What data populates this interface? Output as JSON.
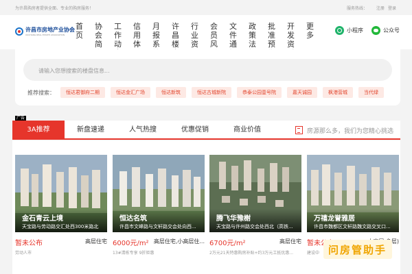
{
  "topbar": {
    "slogan": "为许昌购房者提供全面、专业的购房服务！",
    "service_hotline": "服务热线：",
    "register": "注册",
    "login": "登录"
  },
  "logo": {
    "name": "许昌市房地产业协会",
    "subtitle": "XUCHANG REAL ESTATE ASSOCIATION"
  },
  "nav": [
    "首页",
    "协会简介",
    "工作动态",
    "信用体系",
    "月报系统",
    "许昌楼盘",
    "行业资讯",
    "会员风采",
    "文件通知",
    "政策法规",
    "批准预售",
    "开发资质",
    "更多"
  ],
  "social": {
    "mini_program": "小程序",
    "official_account": "公众号"
  },
  "search": {
    "placeholder": "请输入您想搜索的楼盘信息...",
    "hot_label": "推荐搜索：",
    "tags": [
      "恒达君御府二期",
      "恒达金汇广场",
      "恒达新筑",
      "恒达古城新院",
      "恭泰公园壹号院",
      "嘉天诚园",
      "枫港营城",
      "当代绿"
    ]
  },
  "ad_label": "广告",
  "tabs": [
    "3A推荐",
    "新盘速递",
    "人气热搜",
    "优惠促销",
    "商业价值"
  ],
  "tab_search_text": "房源那么多，我们为您精心挑选",
  "listings": [
    {
      "name": "金石青云上境",
      "address": "天宝路与劳动路交汇处西300米路北",
      "price": "暂未公布",
      "type": "高层住宅",
      "sub": "劳动人市"
    },
    {
      "name": "恒达名筑",
      "address": "许昌市文峰路与文轩路交会处向西...",
      "price": "6000元/m²",
      "type": "高层住宅,小高层住...",
      "sub": "13#清栋专享 9折钜惠"
    },
    {
      "name": "腾飞华豫榭",
      "address": "天宝路与许州路交会处西北（高铁...",
      "price": "6700元/m²",
      "type": "高层住宅",
      "sub": "2万元21天特惠购房补贴+约3万元工抵优惠..."
    },
    {
      "name": "万禧龙誉雅居",
      "address": "许昌市魏都区文轩路魏文路交叉口...",
      "price": "暂未公布",
      "type": "小高层,多层)",
      "sub": "建设中"
    }
  ],
  "watermark": "问房管助手",
  "colors": {
    "accent": "#e6352b",
    "tag_bg": "#fde9e4",
    "logo_blue": "#1b4d9a"
  }
}
